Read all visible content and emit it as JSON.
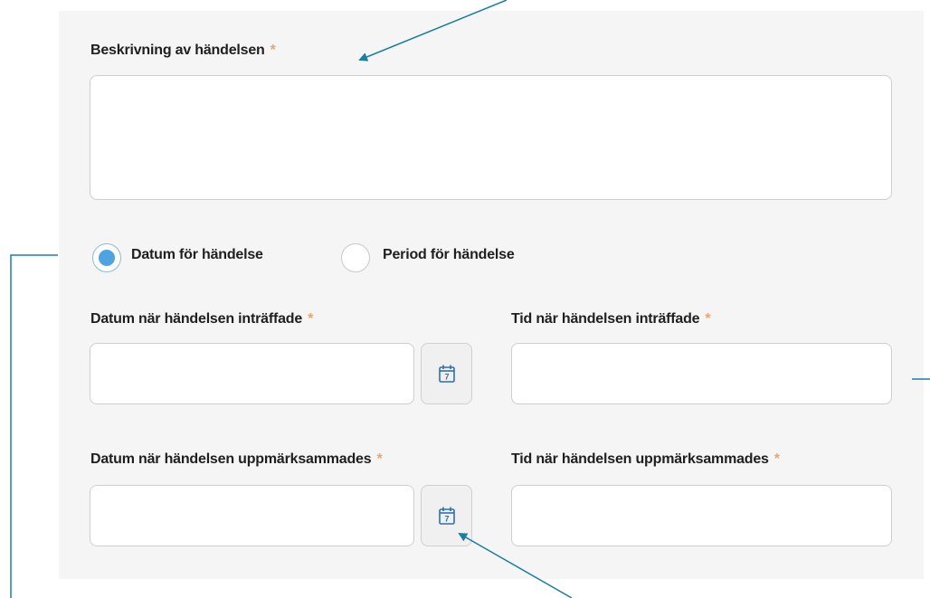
{
  "form": {
    "description": {
      "label": "Beskrivning av händelsen",
      "required_mark": "*",
      "value": ""
    },
    "mode": {
      "options": [
        {
          "label": "Datum för händelse",
          "selected": true
        },
        {
          "label": "Period för händelse",
          "selected": false
        }
      ]
    },
    "occurred_date": {
      "label": "Datum när händelsen inträffade",
      "required_mark": "*",
      "value": "",
      "calendar_icon_text": "7"
    },
    "occurred_time": {
      "label": "Tid när händelsen inträffade",
      "required_mark": "*",
      "value": ""
    },
    "noticed_date": {
      "label": "Datum när händelsen uppmärksammades",
      "required_mark": "*",
      "value": "",
      "calendar_icon_text": "7"
    },
    "noticed_time": {
      "label": "Tid när händelsen uppmärksammades",
      "required_mark": "*",
      "value": ""
    }
  },
  "colors": {
    "required": "#f0a36a",
    "radio_selected": "#4fa3e0",
    "annotation": "#1a7fa0",
    "icon": "#2f6fb0"
  },
  "icons": {
    "calendar": "calendar-icon"
  }
}
